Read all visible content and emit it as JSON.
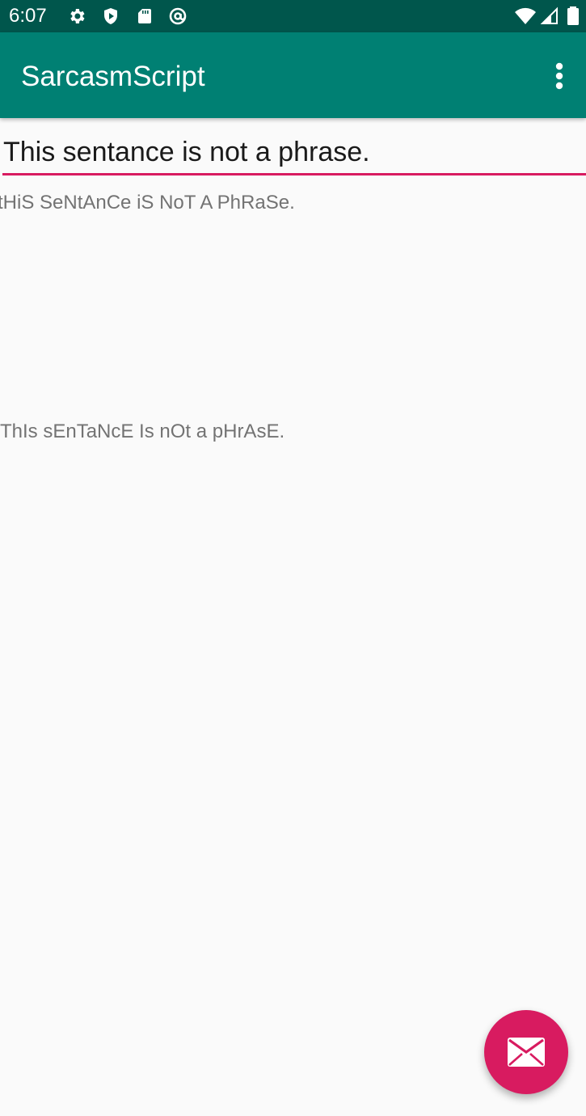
{
  "status_bar": {
    "time": "6:07",
    "icons_left": [
      "settings-icon",
      "shield-play-icon",
      "sd-card-icon",
      "at-sign-icon"
    ],
    "icons_right": [
      "wifi-icon",
      "signal-icon",
      "battery-icon"
    ]
  },
  "app_bar": {
    "title": "SarcasmScript",
    "menu_icon": "overflow-menu-icon"
  },
  "editor": {
    "input_value": "This sentance is not a phrase."
  },
  "outputs": {
    "variant_one": "tHiS SeNtAnCe iS NoT A PhRaSe.",
    "variant_two": "ThIs sEnTaNcE Is nOt a pHrAsE."
  },
  "fab": {
    "icon": "email-icon"
  },
  "colors": {
    "status_bar": "#00564c",
    "app_bar": "#008073",
    "accent": "#d81b60",
    "background": "#fafafa"
  }
}
